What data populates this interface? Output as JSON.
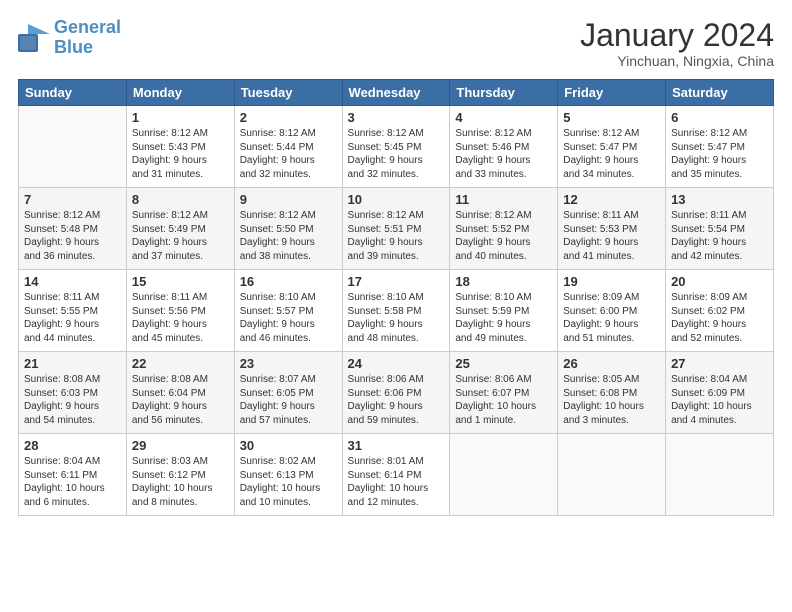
{
  "header": {
    "logo_line1": "General",
    "logo_line2": "Blue",
    "month_title": "January 2024",
    "location": "Yinchuan, Ningxia, China"
  },
  "days_of_week": [
    "Sunday",
    "Monday",
    "Tuesday",
    "Wednesday",
    "Thursday",
    "Friday",
    "Saturday"
  ],
  "weeks": [
    [
      {
        "day": "",
        "content": ""
      },
      {
        "day": "1",
        "content": "Sunrise: 8:12 AM\nSunset: 5:43 PM\nDaylight: 9 hours\nand 31 minutes."
      },
      {
        "day": "2",
        "content": "Sunrise: 8:12 AM\nSunset: 5:44 PM\nDaylight: 9 hours\nand 32 minutes."
      },
      {
        "day": "3",
        "content": "Sunrise: 8:12 AM\nSunset: 5:45 PM\nDaylight: 9 hours\nand 32 minutes."
      },
      {
        "day": "4",
        "content": "Sunrise: 8:12 AM\nSunset: 5:46 PM\nDaylight: 9 hours\nand 33 minutes."
      },
      {
        "day": "5",
        "content": "Sunrise: 8:12 AM\nSunset: 5:47 PM\nDaylight: 9 hours\nand 34 minutes."
      },
      {
        "day": "6",
        "content": "Sunrise: 8:12 AM\nSunset: 5:47 PM\nDaylight: 9 hours\nand 35 minutes."
      }
    ],
    [
      {
        "day": "7",
        "content": "Sunrise: 8:12 AM\nSunset: 5:48 PM\nDaylight: 9 hours\nand 36 minutes."
      },
      {
        "day": "8",
        "content": "Sunrise: 8:12 AM\nSunset: 5:49 PM\nDaylight: 9 hours\nand 37 minutes."
      },
      {
        "day": "9",
        "content": "Sunrise: 8:12 AM\nSunset: 5:50 PM\nDaylight: 9 hours\nand 38 minutes."
      },
      {
        "day": "10",
        "content": "Sunrise: 8:12 AM\nSunset: 5:51 PM\nDaylight: 9 hours\nand 39 minutes."
      },
      {
        "day": "11",
        "content": "Sunrise: 8:12 AM\nSunset: 5:52 PM\nDaylight: 9 hours\nand 40 minutes."
      },
      {
        "day": "12",
        "content": "Sunrise: 8:11 AM\nSunset: 5:53 PM\nDaylight: 9 hours\nand 41 minutes."
      },
      {
        "day": "13",
        "content": "Sunrise: 8:11 AM\nSunset: 5:54 PM\nDaylight: 9 hours\nand 42 minutes."
      }
    ],
    [
      {
        "day": "14",
        "content": "Sunrise: 8:11 AM\nSunset: 5:55 PM\nDaylight: 9 hours\nand 44 minutes."
      },
      {
        "day": "15",
        "content": "Sunrise: 8:11 AM\nSunset: 5:56 PM\nDaylight: 9 hours\nand 45 minutes."
      },
      {
        "day": "16",
        "content": "Sunrise: 8:10 AM\nSunset: 5:57 PM\nDaylight: 9 hours\nand 46 minutes."
      },
      {
        "day": "17",
        "content": "Sunrise: 8:10 AM\nSunset: 5:58 PM\nDaylight: 9 hours\nand 48 minutes."
      },
      {
        "day": "18",
        "content": "Sunrise: 8:10 AM\nSunset: 5:59 PM\nDaylight: 9 hours\nand 49 minutes."
      },
      {
        "day": "19",
        "content": "Sunrise: 8:09 AM\nSunset: 6:00 PM\nDaylight: 9 hours\nand 51 minutes."
      },
      {
        "day": "20",
        "content": "Sunrise: 8:09 AM\nSunset: 6:02 PM\nDaylight: 9 hours\nand 52 minutes."
      }
    ],
    [
      {
        "day": "21",
        "content": "Sunrise: 8:08 AM\nSunset: 6:03 PM\nDaylight: 9 hours\nand 54 minutes."
      },
      {
        "day": "22",
        "content": "Sunrise: 8:08 AM\nSunset: 6:04 PM\nDaylight: 9 hours\nand 56 minutes."
      },
      {
        "day": "23",
        "content": "Sunrise: 8:07 AM\nSunset: 6:05 PM\nDaylight: 9 hours\nand 57 minutes."
      },
      {
        "day": "24",
        "content": "Sunrise: 8:06 AM\nSunset: 6:06 PM\nDaylight: 9 hours\nand 59 minutes."
      },
      {
        "day": "25",
        "content": "Sunrise: 8:06 AM\nSunset: 6:07 PM\nDaylight: 10 hours\nand 1 minute."
      },
      {
        "day": "26",
        "content": "Sunrise: 8:05 AM\nSunset: 6:08 PM\nDaylight: 10 hours\nand 3 minutes."
      },
      {
        "day": "27",
        "content": "Sunrise: 8:04 AM\nSunset: 6:09 PM\nDaylight: 10 hours\nand 4 minutes."
      }
    ],
    [
      {
        "day": "28",
        "content": "Sunrise: 8:04 AM\nSunset: 6:11 PM\nDaylight: 10 hours\nand 6 minutes."
      },
      {
        "day": "29",
        "content": "Sunrise: 8:03 AM\nSunset: 6:12 PM\nDaylight: 10 hours\nand 8 minutes."
      },
      {
        "day": "30",
        "content": "Sunrise: 8:02 AM\nSunset: 6:13 PM\nDaylight: 10 hours\nand 10 minutes."
      },
      {
        "day": "31",
        "content": "Sunrise: 8:01 AM\nSunset: 6:14 PM\nDaylight: 10 hours\nand 12 minutes."
      },
      {
        "day": "",
        "content": ""
      },
      {
        "day": "",
        "content": ""
      },
      {
        "day": "",
        "content": ""
      }
    ]
  ]
}
